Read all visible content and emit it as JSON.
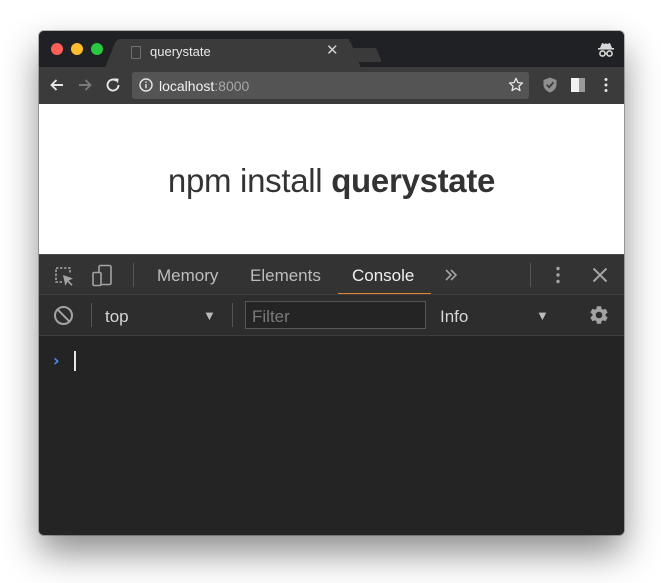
{
  "browser": {
    "tab": {
      "title": "querystate",
      "close_icon": "close-icon"
    },
    "toolbar": {
      "back_icon": "arrow-left-icon",
      "forward_icon": "arrow-right-icon",
      "reload_icon": "reload-icon",
      "info_icon": "info-icon",
      "url_host": "localhost",
      "url_port": ":8000",
      "star_icon": "star-icon",
      "extension_icons": [
        "shield-icon",
        "book-icon"
      ],
      "menu_icon": "more-vertical-icon"
    },
    "incognito_icon": "incognito-icon"
  },
  "page": {
    "heading_prefix": "npm install ",
    "heading_strong": "querystate"
  },
  "devtools": {
    "tabs": [
      {
        "label": "Memory",
        "active": false
      },
      {
        "label": "Elements",
        "active": false
      },
      {
        "label": "Console",
        "active": true
      }
    ],
    "more_tabs_icon": "chevron-double-right-icon",
    "console": {
      "context": "top",
      "filter_placeholder": "Filter",
      "level": "Info",
      "prompt_glyph": "›"
    }
  },
  "colors": {
    "accent_active_tab": "#e0842f",
    "prompt": "#4a8ef7",
    "close_traffic": "#fe5f57",
    "minimize_traffic": "#febc2e",
    "maximize_traffic": "#28c840"
  }
}
